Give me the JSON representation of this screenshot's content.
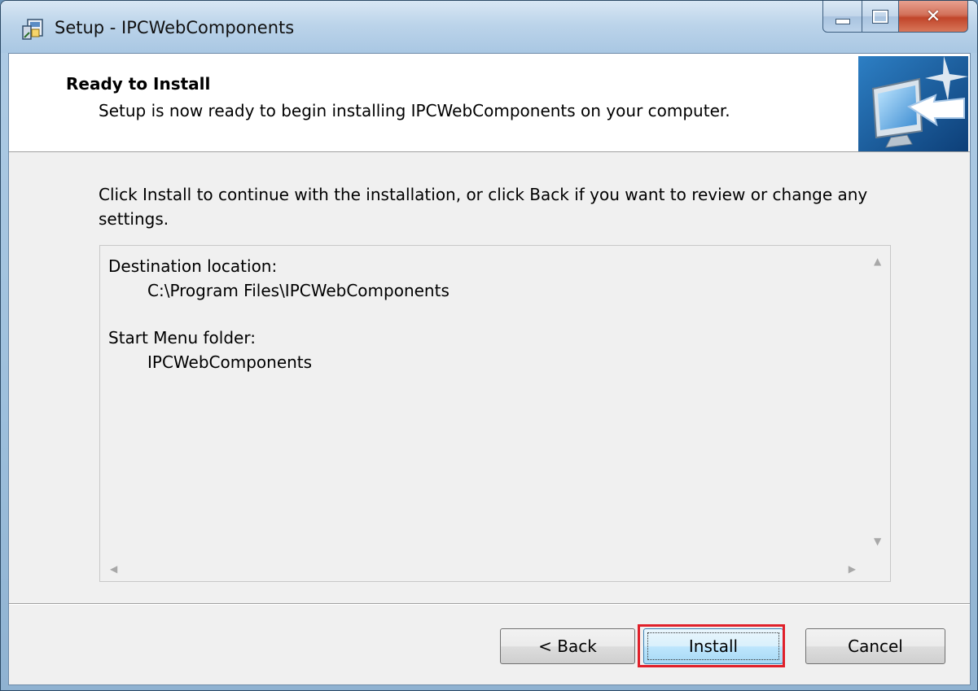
{
  "window": {
    "title": "Setup - IPCWebComponents",
    "controls": {
      "minimize": "minimize-icon",
      "maximize": "maximize-icon",
      "close": "close-icon"
    },
    "accent_color": "#c1452a"
  },
  "header": {
    "title": "Ready to Install",
    "subtitle": "Setup is now ready to begin installing IPCWebComponents on your computer.",
    "image": "monitor-install-icon"
  },
  "body": {
    "instructions": "Click Install to continue with the installation, or click Back if you want to review or change any settings."
  },
  "memo": {
    "destination_label": "Destination location:",
    "destination_value": "C:\\Program Files\\IPCWebComponents",
    "start_menu_label": "Start Menu folder:",
    "start_menu_value": "IPCWebComponents"
  },
  "buttons": {
    "back": "< Back",
    "install": "Install",
    "cancel": "Cancel",
    "highlight_color": "#e0202a"
  }
}
